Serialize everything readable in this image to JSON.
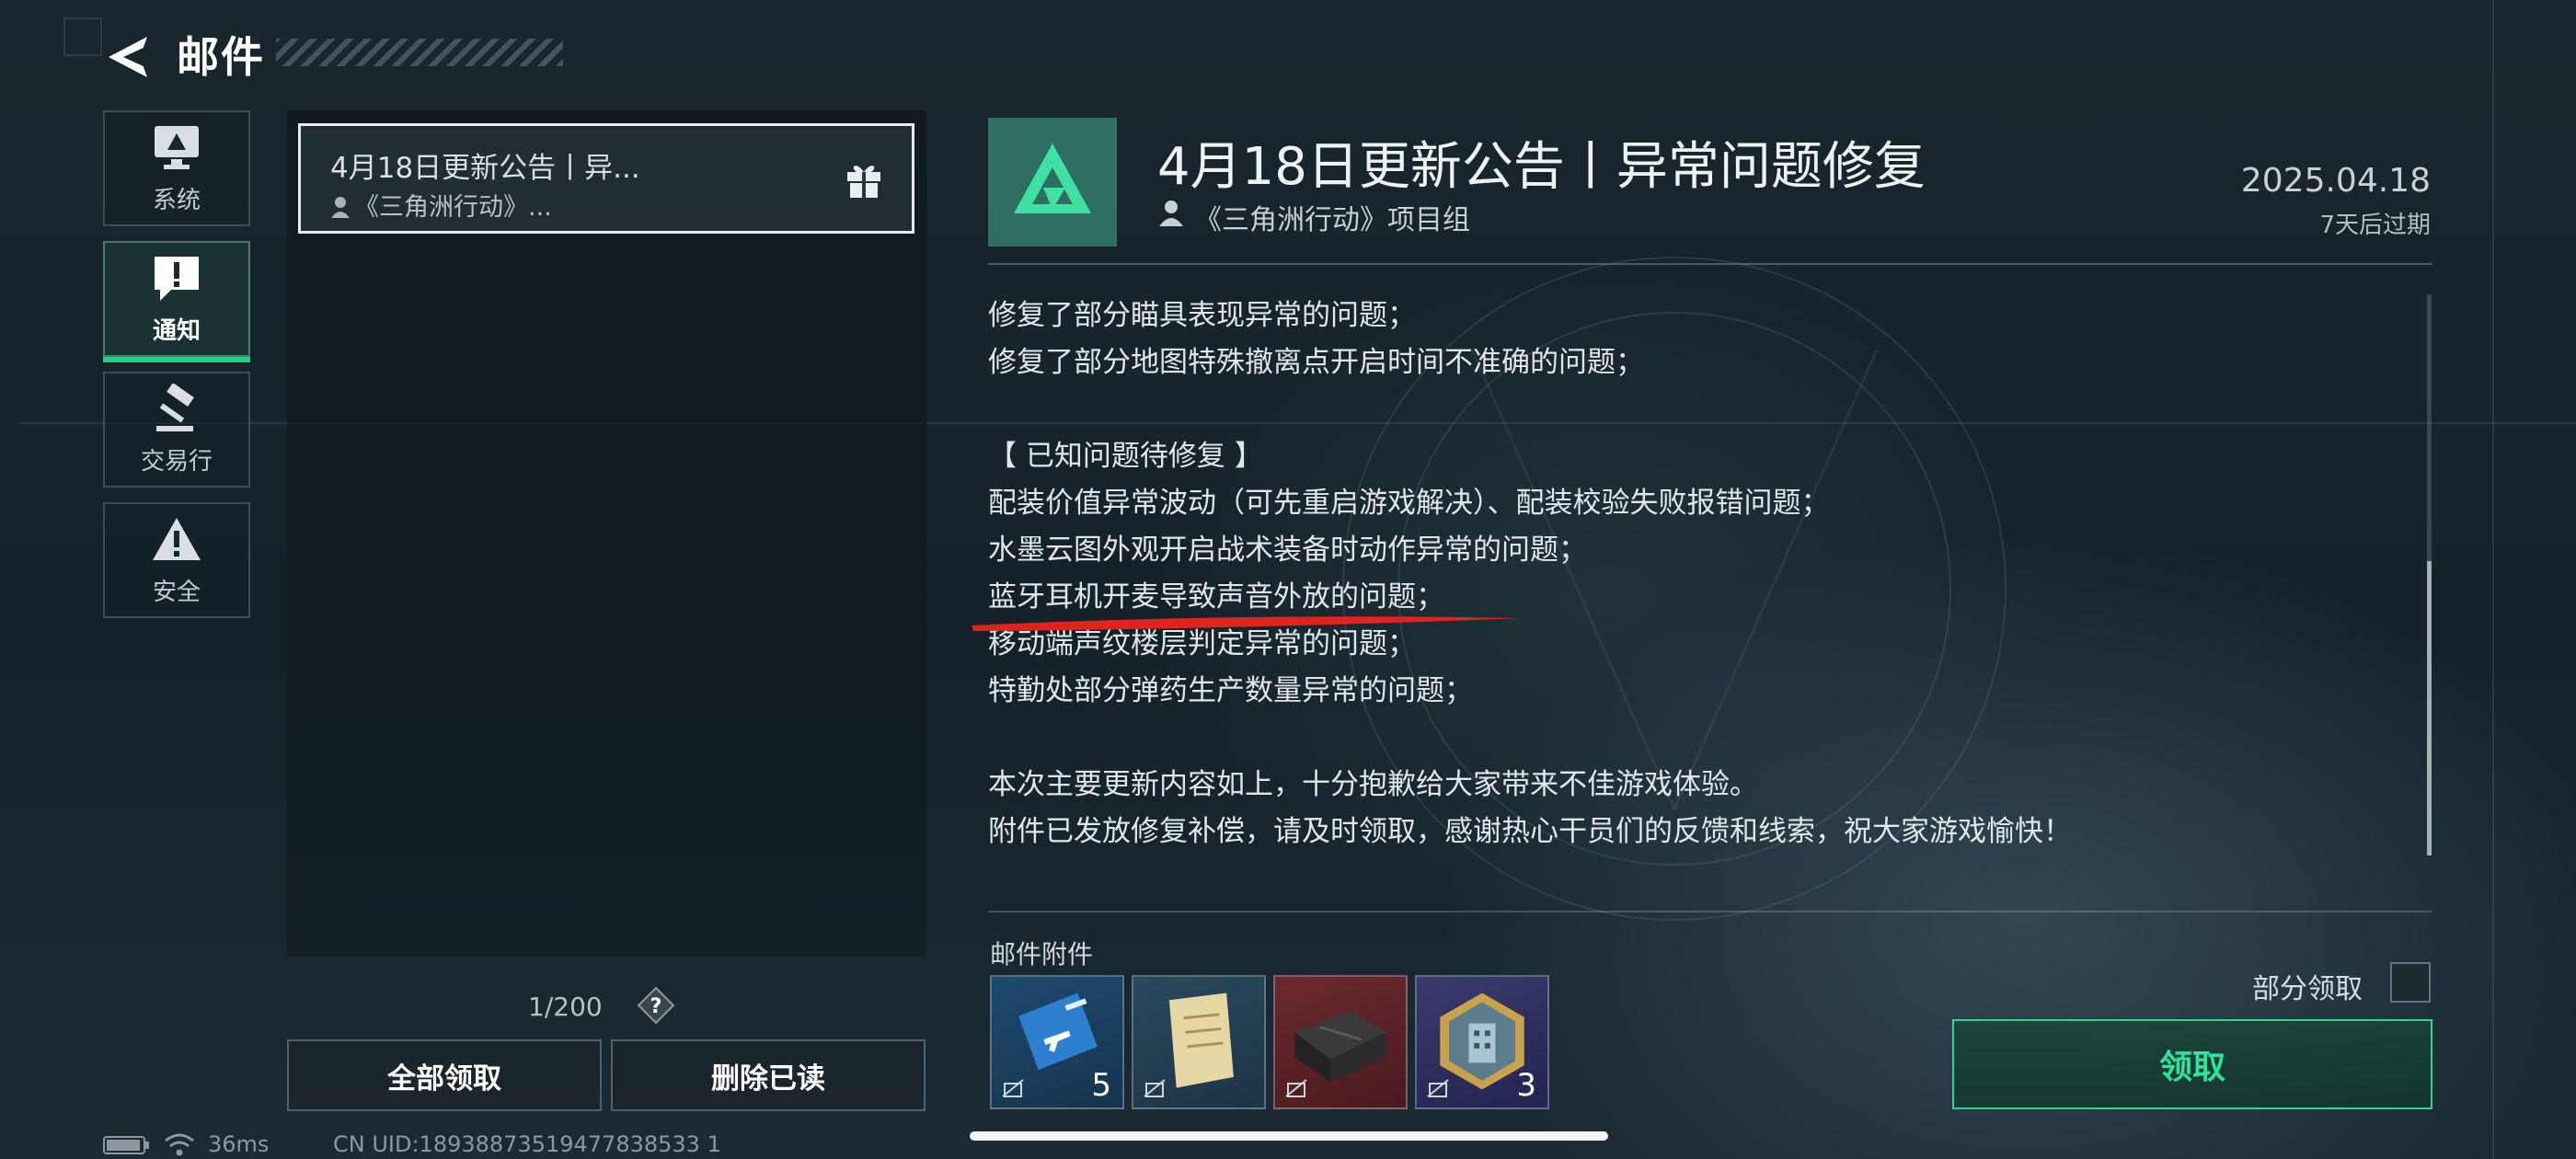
{
  "header": {
    "title": "邮件"
  },
  "categories": [
    {
      "label": "系统",
      "icon": "monitor-icon",
      "active": false
    },
    {
      "label": "通知",
      "icon": "alert-icon",
      "active": true
    },
    {
      "label": "交易行",
      "icon": "gavel-icon",
      "active": false
    },
    {
      "label": "安全",
      "icon": "warning-icon",
      "active": false
    }
  ],
  "mail_list": {
    "items": [
      {
        "title": "4月18日更新公告丨异...",
        "sender": "《三角洲行动》...",
        "icon": "gift-icon"
      }
    ],
    "pagination": "1/200",
    "claim_all_label": "全部领取",
    "delete_read_label": "删除已读"
  },
  "status_bar": {
    "ping": "36ms",
    "uid": "CN UID:18938873519477838533 1"
  },
  "detail": {
    "title": "4月18日更新公告丨异常问题修复",
    "sender": "《三角洲行动》项目组",
    "date": "2025.04.18",
    "expiry": "7天后过期",
    "body_lines": [
      "修复了部分瞄具表现异常的问题；",
      "修复了部分地图特殊撤离点开启时间不准确的问题；",
      "",
      "【 已知问题待修复 】",
      "配装价值异常波动（可先重启游戏解决）、配装校验失败报错问题；",
      "水墨云图外观开启战术装备时动作异常的问题；",
      "蓝牙耳机开麦导致声音外放的问题；",
      "移动端声纹楼层判定异常的问题；",
      "特勤处部分弹药生产数量异常的问题；",
      "",
      "本次主要更新内容如上，十分抱歉给大家带来不佳游戏体验。",
      "附件已发放修复补偿，请及时领取，感谢热心干员们的反馈和线索，祝大家游戏愉快！"
    ],
    "attachments_label": "邮件附件",
    "attachments": [
      {
        "name": "blue-card-item-icon",
        "quantity": "5"
      },
      {
        "name": "document-item-icon",
        "quantity": ""
      },
      {
        "name": "black-case-item-icon",
        "quantity": ""
      },
      {
        "name": "hex-badge-item-icon",
        "quantity": "3"
      }
    ],
    "partial_claim_label": "部分领取",
    "claim_label": "领取"
  },
  "colors": {
    "accent": "#22d08a",
    "annotation": "#e0231c"
  }
}
